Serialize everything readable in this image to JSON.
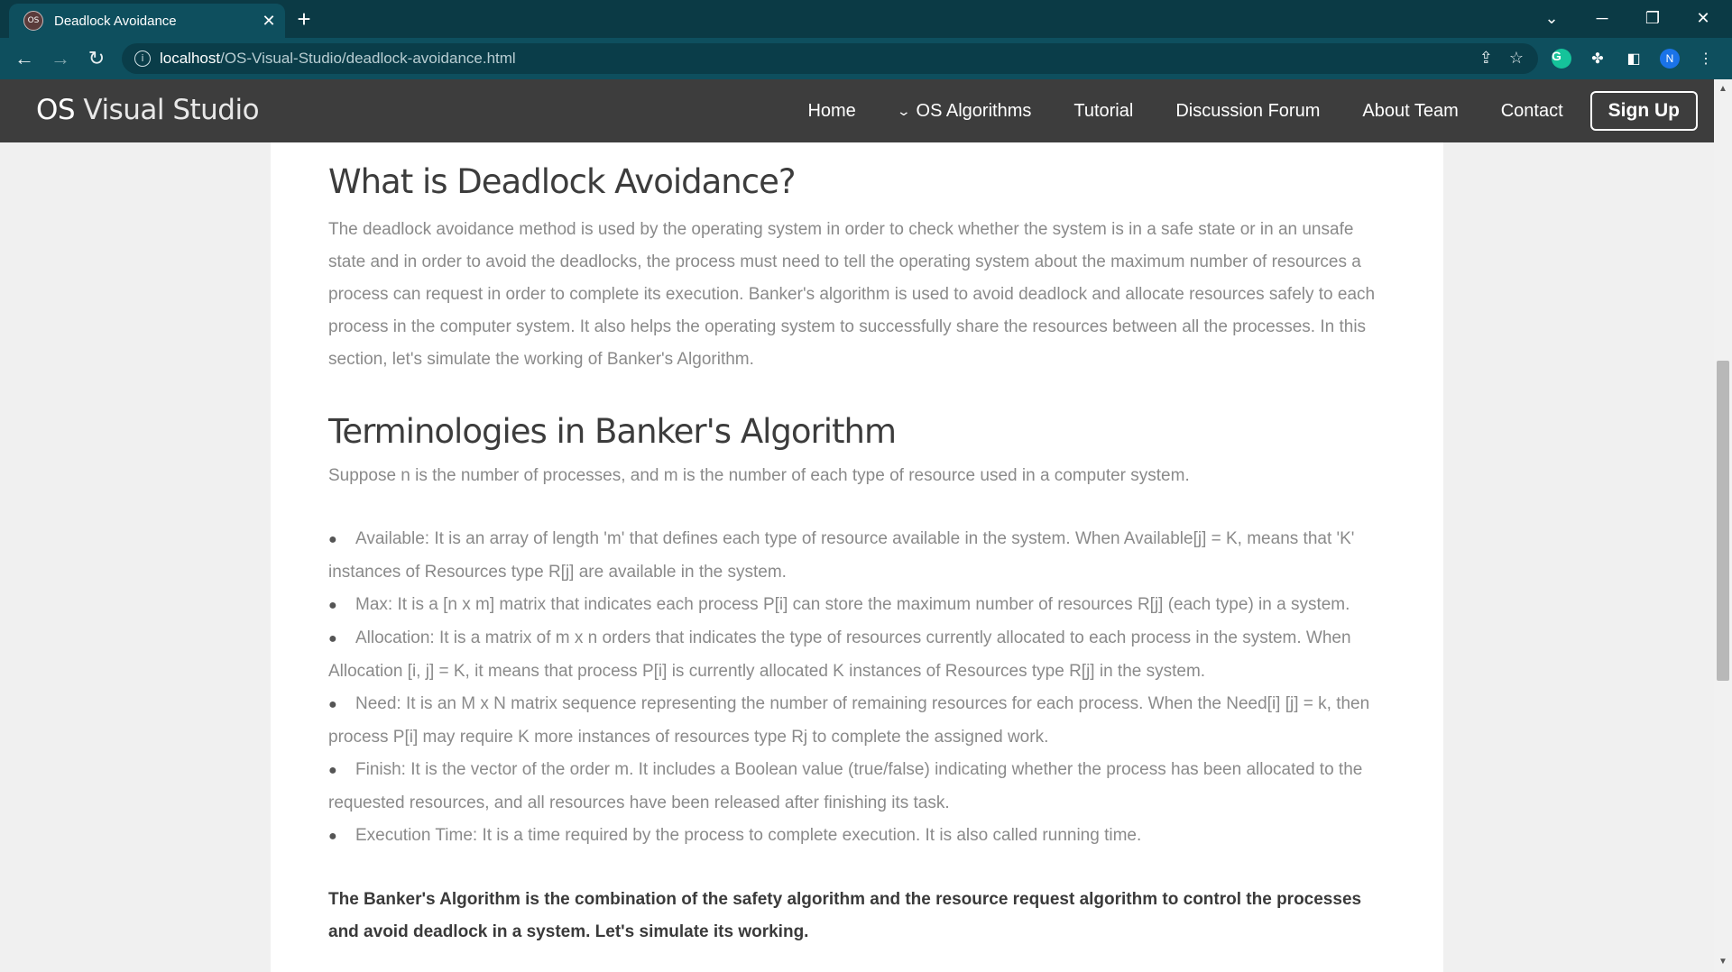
{
  "browser": {
    "tab_title": "Deadlock Avoidance",
    "favicon_text": "OS",
    "url_host": "localhost",
    "url_path": "/OS-Visual-Studio/deadlock-avoidance.html",
    "profile_initial": "N"
  },
  "site": {
    "brand_prefix": "OS",
    "brand_rest": " Visual Studio",
    "nav": {
      "home": "Home",
      "algorithms": "OS Algorithms",
      "tutorial": "Tutorial",
      "forum": "Discussion Forum",
      "team": "About Team",
      "contact": "Contact",
      "signup": "Sign Up"
    }
  },
  "content": {
    "heading1": "What is Deadlock Avoidance?",
    "para1": "The deadlock avoidance method is used by the operating system in order to check whether the system is in a safe state or in an unsafe state and in order to avoid the deadlocks, the process must need to tell the operating system about the maximum number of resources a process can request in order to complete its execution. Banker's algorithm is used to avoid deadlock and allocate resources safely to each process in the computer system. It also helps the operating system to successfully share the resources between all the processes. In this section, let's simulate the working of Banker's Algorithm.",
    "heading2": "Terminologies in Banker's Algorithm",
    "para2": "Suppose n is the number of processes, and m is the number of each type of resource used in a computer system.",
    "terms": [
      "Available: It is an array of length 'm' that defines each type of resource available in the system. When Available[j] = K, means that 'K' instances of Resources type R[j] are available in the system.",
      "Max: It is a [n x m] matrix that indicates each process P[i] can store the maximum number of resources R[j] (each type) in a system.",
      "Allocation: It is a matrix of m x n orders that indicates the type of resources currently allocated to each process in the system. When Allocation [i, j] = K, it means that process P[i] is currently allocated K instances of Resources type R[j] in the system.",
      "Need: It is an M x N matrix sequence representing the number of remaining resources for each process. When the Need[i] [j] = k, then process P[i] may require K more instances of resources type Rj to complete the assigned work.",
      "Finish: It is the vector of the order m. It includes a Boolean value (true/false) indicating whether the process has been allocated to the requested resources, and all resources have been released after finishing its task.",
      "Execution Time: It is a time required by the process to complete execution. It is also called running time."
    ],
    "bold_para": "The Banker's Algorithm is the combination of the safety algorithm and the resource request algorithm to control the processes and avoid deadlock in a system. Let's simulate its working."
  }
}
